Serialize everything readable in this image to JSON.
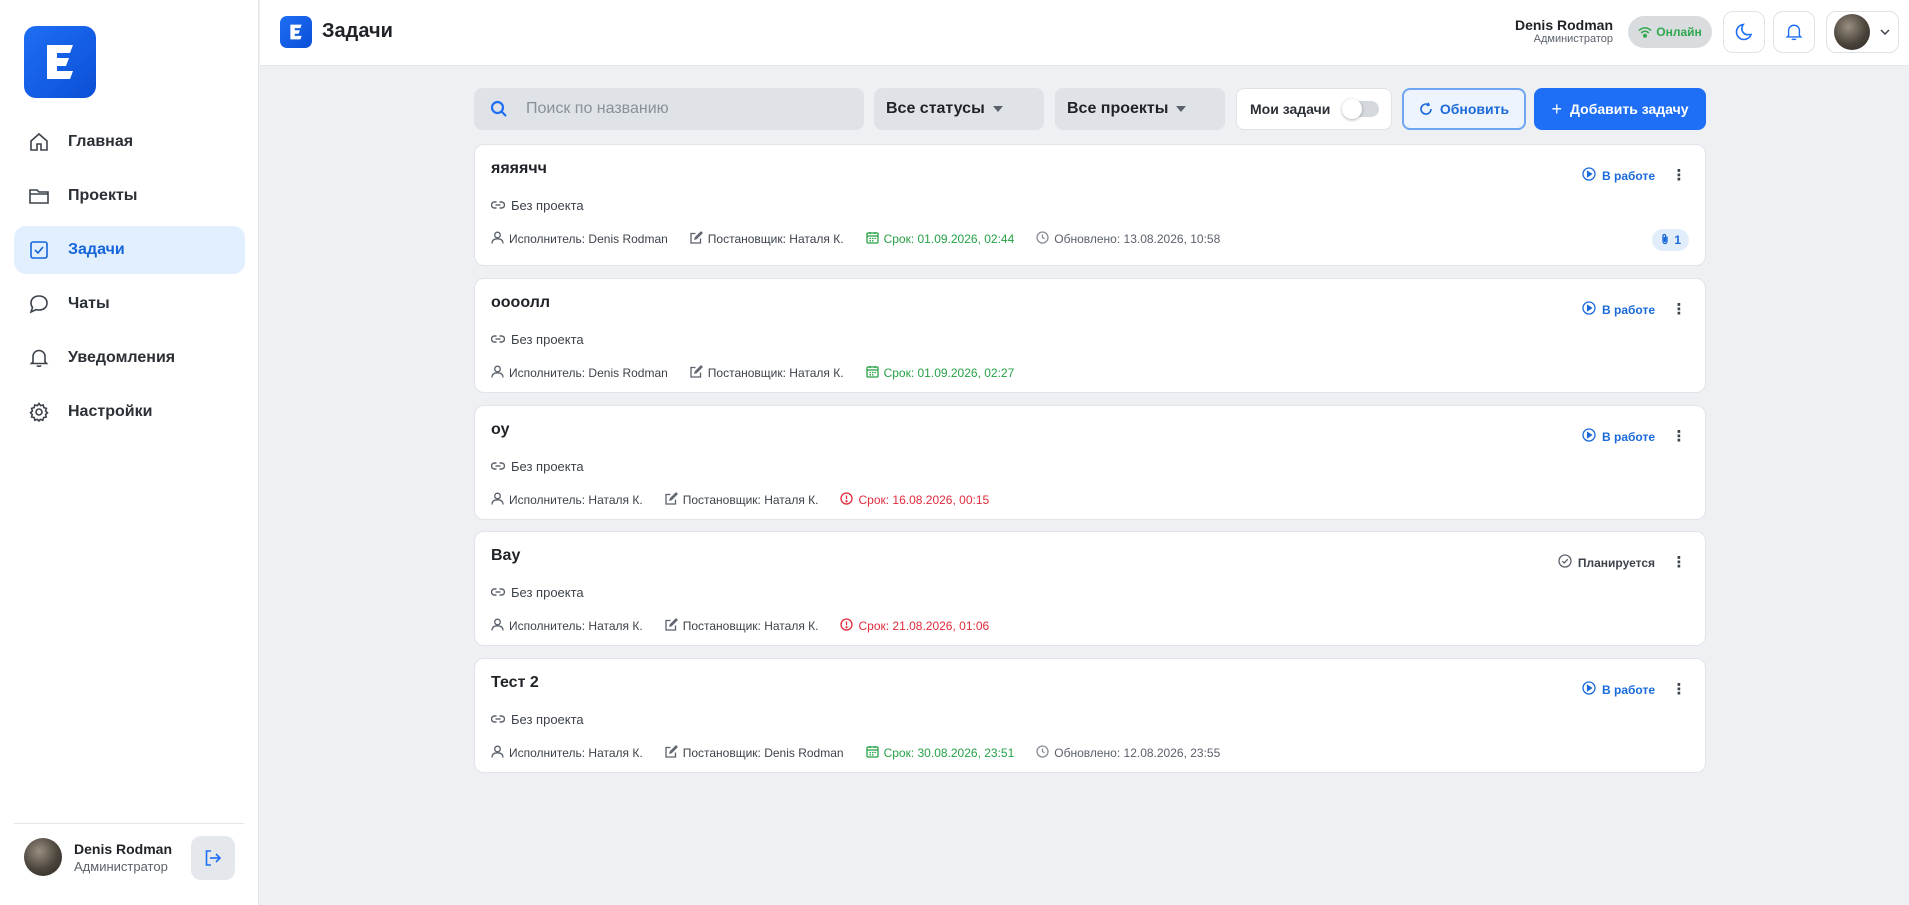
{
  "app": {
    "page_title": "Задачи"
  },
  "sidebar": {
    "items": [
      {
        "label": "Главная",
        "icon": "home-icon"
      },
      {
        "label": "Проекты",
        "icon": "folder-icon"
      },
      {
        "label": "Задачи",
        "icon": "checkbox-icon",
        "active": true
      },
      {
        "label": "Чаты",
        "icon": "chat-icon"
      },
      {
        "label": "Уведомления",
        "icon": "bell-icon"
      },
      {
        "label": "Настройки",
        "icon": "gear-icon"
      }
    ],
    "user": {
      "name": "Denis Rodman",
      "role": "Администратор"
    }
  },
  "header": {
    "user_name": "Denis Rodman",
    "user_role": "Администратор",
    "online_label": "Онлайн"
  },
  "toolbar": {
    "search_placeholder": "Поиск по названию",
    "status_filter": "Все статусы",
    "project_filter": "Все проекты",
    "my_tasks_label": "Мои задачи",
    "my_tasks_on": false,
    "refresh_label": "Обновить",
    "add_label": "Добавить задачу"
  },
  "tasks": [
    {
      "title": "яяяячч",
      "project": "Без проекта",
      "executor": "Исполнитель: Denis Rodman",
      "assigner": "Постановщик: Наталя К.",
      "deadline": "Срок: 01.09.2026, 02:44",
      "deadline_state": "ok",
      "updated": "Обновлено: 13.08.2026, 10:58",
      "status": "В работе",
      "attachments": "1"
    },
    {
      "title": "ооoолл",
      "project": "Без проекта",
      "executor": "Исполнитель: Denis Rodman",
      "assigner": "Постановщик: Наталя К.",
      "deadline": "Срок: 01.09.2026, 02:27",
      "deadline_state": "ok",
      "status": "В работе"
    },
    {
      "title": "оу",
      "project": "Без проекта",
      "executor": "Исполнитель: Наталя К.",
      "assigner": "Постановщик: Наталя К.",
      "deadline": "Срок: 16.08.2026, 00:15",
      "deadline_state": "overdue",
      "status": "В работе"
    },
    {
      "title": "Вау",
      "project": "Без проекта",
      "executor": "Исполнитель: Наталя К.",
      "assigner": "Постановщик: Наталя К.",
      "deadline": "Срок: 21.08.2026, 01:06",
      "deadline_state": "overdue",
      "status": "Планируется"
    },
    {
      "title": "Тест 2",
      "project": "Без проекта",
      "executor": "Исполнитель: Наталя К.",
      "assigner": "Постановщик: Denis Rodman",
      "deadline": "Срок: 30.08.2026, 23:51",
      "deadline_state": "ok",
      "updated": "Обновлено: 12.08.2026, 23:55",
      "status": "В работе"
    }
  ],
  "colors": {
    "accent": "#1e6ff5",
    "active_nav_bg": "#e2efff",
    "deadline_ok": "#26a146",
    "deadline_overdue": "#e02c3c",
    "online": "#2fa84f"
  }
}
